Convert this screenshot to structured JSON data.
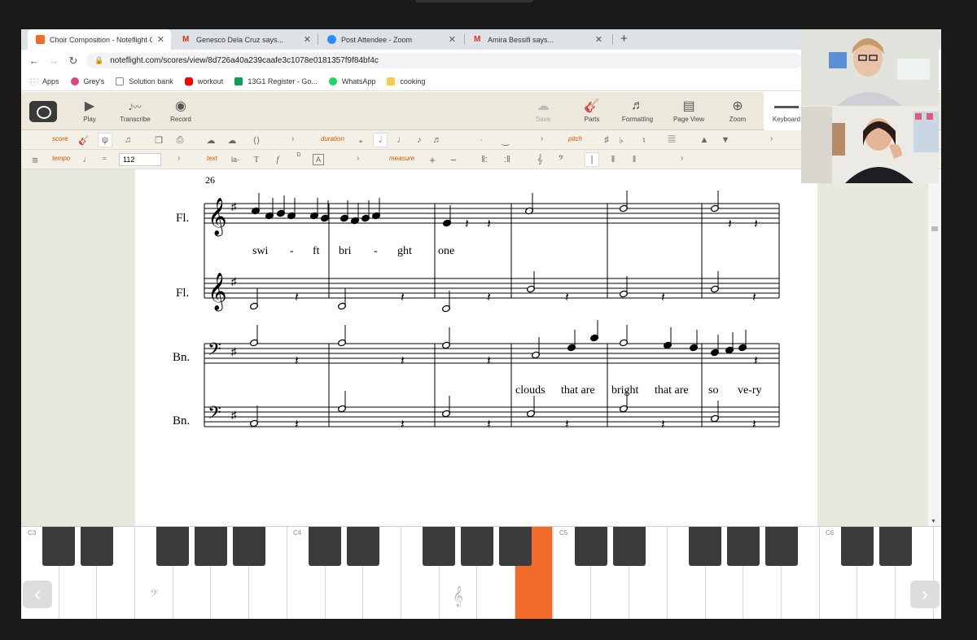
{
  "browser": {
    "tabs": [
      {
        "label": "Choir Composition - Noteflight C",
        "icon": "noteflight-icon",
        "active": true
      },
      {
        "label": "Genesco Dela Cruz says...",
        "icon": "gmail-icon",
        "active": false
      },
      {
        "label": "Post Attendee - Zoom",
        "icon": "zoom-icon",
        "active": false
      },
      {
        "label": "Amira Bessifi says...",
        "icon": "gmail-icon",
        "active": false
      }
    ],
    "new_tab": "+",
    "url": "noteflight.com/scores/view/8d726a40a239caafe3c1078e0181357f9f84bf4c",
    "bookmarks": [
      {
        "label": "Apps",
        "icon": "apps-grid-icon"
      },
      {
        "label": "Grey's",
        "icon": "play-circle-icon"
      },
      {
        "label": "Solution bank",
        "icon": "page-icon"
      },
      {
        "label": "workout",
        "icon": "youtube-icon"
      },
      {
        "label": "13G1 Register - Go...",
        "icon": "sheets-icon"
      },
      {
        "label": "WhatsApp",
        "icon": "whatsapp-icon"
      },
      {
        "label": "cooking",
        "icon": "folder-icon"
      }
    ]
  },
  "noteflight": {
    "toolbar": {
      "play": "Play",
      "transcribe": "Transcribe",
      "record": "Record",
      "save": "Save",
      "parts": "Parts",
      "formatting": "Formatting",
      "page_view": "Page View",
      "zoom": "Zoom",
      "keyboard": "Keyboard"
    },
    "palette": {
      "score": "score",
      "duration": "duration",
      "pitch": "pitch",
      "tempo": "tempo",
      "text": "text",
      "measure": "measure",
      "tempo_equals": "=",
      "tempo_value": "112",
      "text_lyric": "la-",
      "text_font": "T",
      "text_dyn": "f",
      "chord_letter": "D",
      "text_box": "A"
    }
  },
  "score": {
    "measure_number": "26",
    "staves": [
      {
        "name": "Fl.",
        "clef": "treble",
        "key": "G major (1 sharp)"
      },
      {
        "name": "Fl.",
        "clef": "treble",
        "key": "G major (1 sharp)"
      },
      {
        "name": "Bn.",
        "clef": "bass",
        "key": "G major (1 sharp)"
      },
      {
        "name": "Bn.",
        "clef": "bass",
        "key": "G major (1 sharp)"
      }
    ],
    "lyrics_flute": [
      "swi",
      "-",
      "ft",
      "bri",
      "-",
      "ght",
      "one"
    ],
    "lyrics_bassoon": [
      "clouds",
      "that are",
      "bright",
      "that are",
      "so",
      "ve-ry"
    ]
  },
  "piano": {
    "octave_labels": [
      "C3",
      "C4",
      "C5",
      "C6"
    ],
    "highlight_color": "#f26b2a",
    "left_arrow": "‹",
    "right_arrow": "›",
    "bass_clef_glyph": "𝄢",
    "treble_clef_glyph": "𝄞"
  }
}
